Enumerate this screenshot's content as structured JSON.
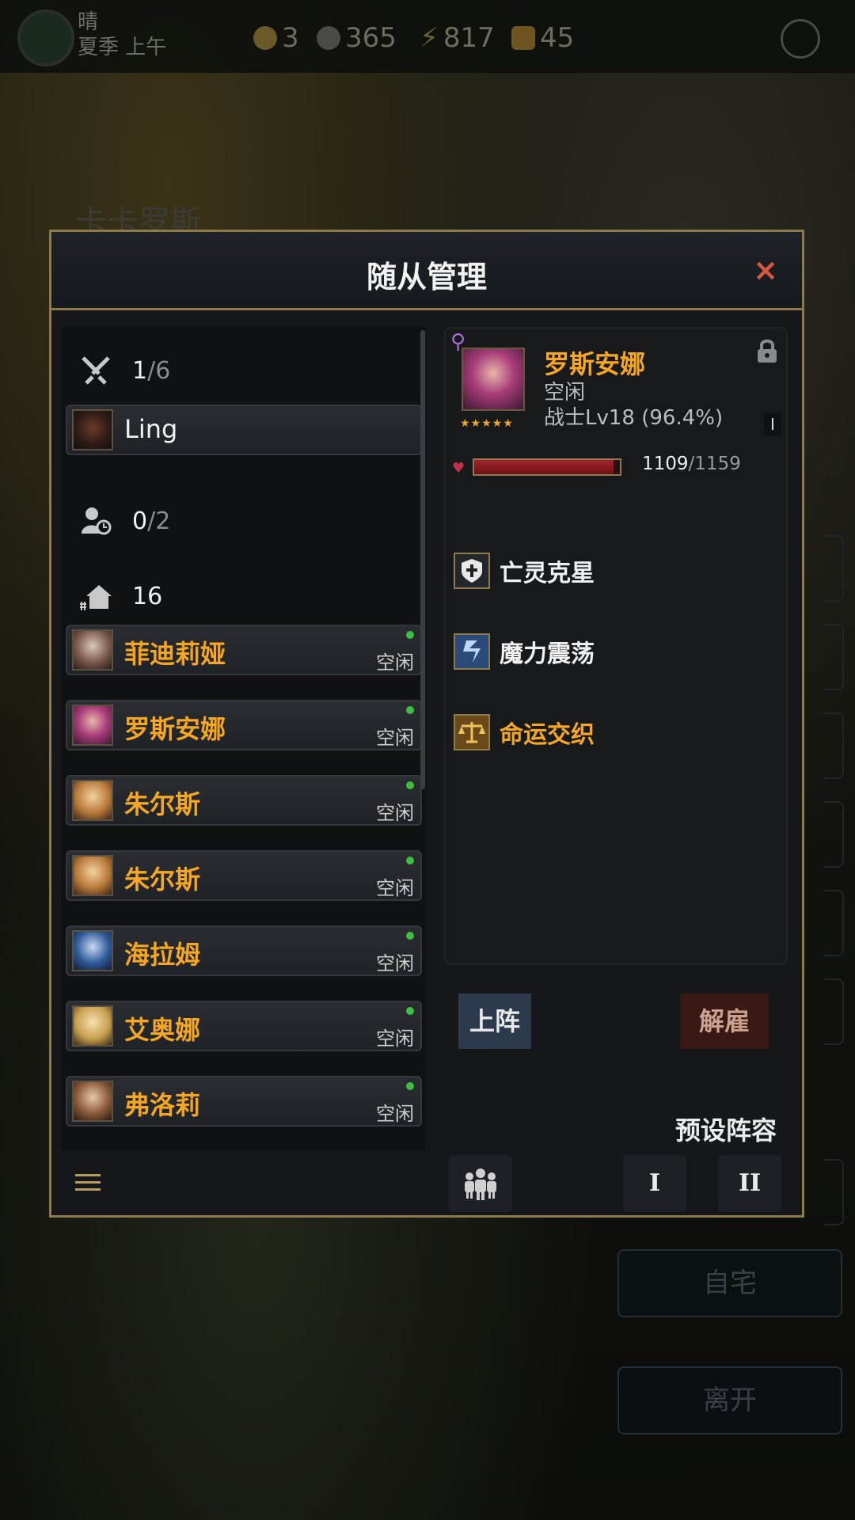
{
  "topbar": {
    "weather": "晴",
    "season_time": "夏季 上午",
    "resources": [
      {
        "icon": "gold-coin-icon",
        "value": "3",
        "color": "#c9a23a"
      },
      {
        "icon": "silver-coin-icon",
        "value": "365",
        "color": "#9a9a9a"
      },
      {
        "icon": "energy-bolt-icon",
        "value": "817",
        "color": "#d0c24a"
      },
      {
        "icon": "gem-icon",
        "value": "45",
        "color": "#d8a432"
      }
    ]
  },
  "background": {
    "location_title": "卡卡罗斯",
    "buttons": [
      "自宅",
      "离开"
    ]
  },
  "modal": {
    "title": "随从管理",
    "close_glyph": "×"
  },
  "party": {
    "battle": {
      "current": "1",
      "sep": "/",
      "max": "6"
    },
    "player": {
      "name": "Ling"
    },
    "reserve": {
      "current": "0",
      "sep": "/",
      "max": "2"
    },
    "housing": {
      "value": "16"
    }
  },
  "followers": [
    {
      "name": "菲迪莉娅",
      "status": "空闲"
    },
    {
      "name": "罗斯安娜",
      "status": "空闲"
    },
    {
      "name": "朱尔斯",
      "status": "空闲"
    },
    {
      "name": "朱尔斯",
      "status": "空闲"
    },
    {
      "name": "海拉姆",
      "status": "空闲"
    },
    {
      "name": "艾奥娜",
      "status": "空闲"
    },
    {
      "name": "弗洛莉",
      "status": "空闲"
    }
  ],
  "detail": {
    "gender_glyph": "⚲",
    "stars": "★★★★★",
    "name": "罗斯安娜",
    "state": "空闲",
    "level": "战士Lv18 (96.4%)",
    "tag": "I",
    "hp": {
      "current": "1109",
      "rest": "/1159",
      "fraction": 0.957
    },
    "skills": [
      {
        "name": "亡灵克星",
        "icon": "shield-cross-icon",
        "rarity": "normal"
      },
      {
        "name": "魔力震荡",
        "icon": "lightning-icon",
        "rarity": "normal"
      },
      {
        "name": "命运交织",
        "icon": "scales-icon",
        "rarity": "gold"
      }
    ]
  },
  "actions": {
    "deploy": "上阵",
    "dismiss": "解雇",
    "preset_label": "预设阵容",
    "preset_1": "I",
    "preset_2": "II"
  },
  "colors": {
    "accent_gold": "#f5a623",
    "frame_gold": "#8e7a4a",
    "online": "#3fbf3f",
    "close": "#d9583d"
  }
}
